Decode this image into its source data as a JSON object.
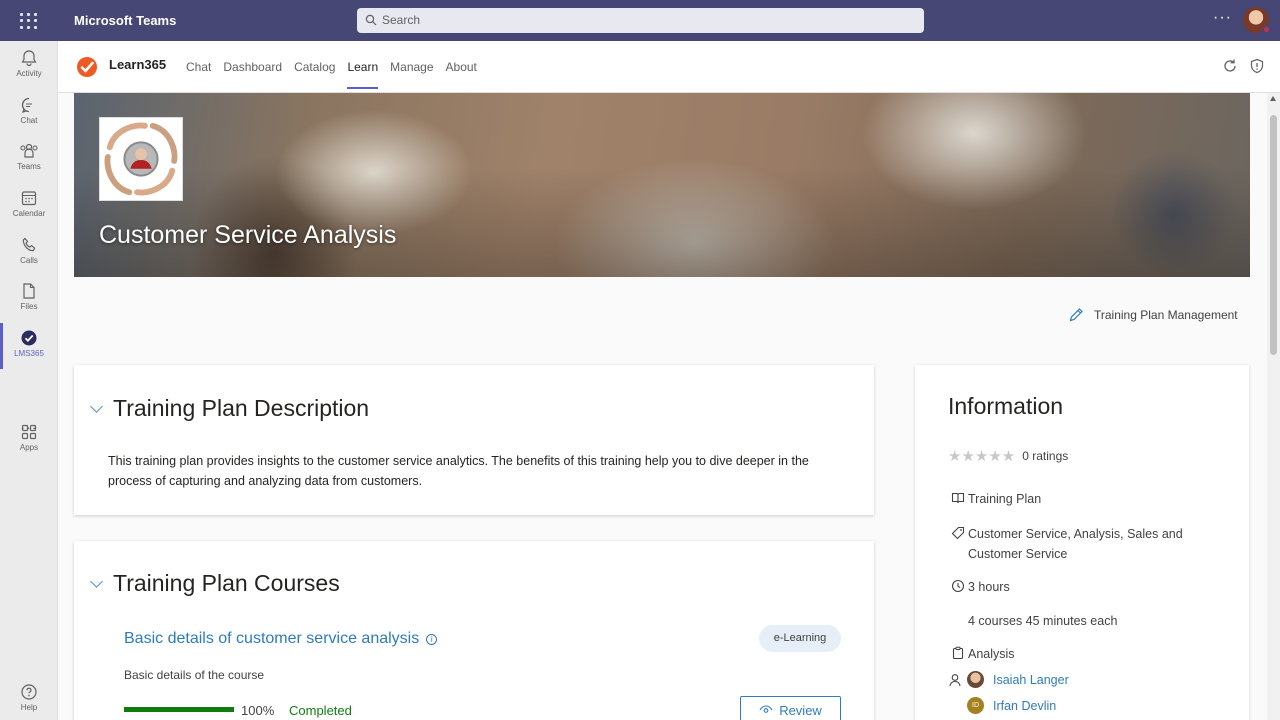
{
  "titlebar": {
    "app_name": "Microsoft Teams",
    "search_placeholder": "Search",
    "more": "···"
  },
  "rail": {
    "items": [
      {
        "label": "Activity",
        "icon": "bell-icon"
      },
      {
        "label": "Chat",
        "icon": "chat-icon"
      },
      {
        "label": "Teams",
        "icon": "teams-icon"
      },
      {
        "label": "Calendar",
        "icon": "calendar-icon"
      },
      {
        "label": "Calls",
        "icon": "phone-icon"
      },
      {
        "label": "Files",
        "icon": "file-icon"
      },
      {
        "label": "LMS365",
        "icon": "lms365-icon",
        "active": true
      },
      {
        "label": "Apps",
        "icon": "apps-icon"
      },
      {
        "label": "Help",
        "icon": "help-icon"
      }
    ],
    "more": "···"
  },
  "app": {
    "name": "Learn365",
    "tabs": [
      "Chat",
      "Dashboard",
      "Catalog",
      "Learn",
      "Manage",
      "About"
    ],
    "active_tab": "Learn"
  },
  "hero": {
    "title": "Customer Service Analysis"
  },
  "management_link": "Training Plan Management",
  "description": {
    "heading": "Training Plan Description",
    "text": "This training plan provides insights to the customer service analytics. The benefits of this training help you to dive deeper in the process of capturing and analyzing data from customers."
  },
  "courses": {
    "heading": "Training Plan Courses",
    "items": [
      {
        "title": "Basic details of customer service analysis",
        "badge": "e-Learning",
        "subtitle": "Basic details of the course",
        "progress": 1.0,
        "progress_label": "100%",
        "status": "Completed",
        "action": "Review"
      }
    ]
  },
  "information": {
    "heading": "Information",
    "stars": "★★★★★",
    "ratings": "0 ratings",
    "type": "Training Plan",
    "tags": "Customer Service, Analysis, Sales and Customer Service",
    "duration": "3 hours",
    "duration_detail": "4 courses 45 minutes each",
    "category": "Analysis",
    "people": [
      {
        "name": "Isaiah Langer",
        "avatar": "photo"
      },
      {
        "name": "Irfan Devlin",
        "initials": "ID"
      }
    ]
  },
  "colors": {
    "teams_purple": "#464775",
    "accent": "#5b5fc7",
    "link": "#2f7bbf",
    "success": "#107c10"
  }
}
